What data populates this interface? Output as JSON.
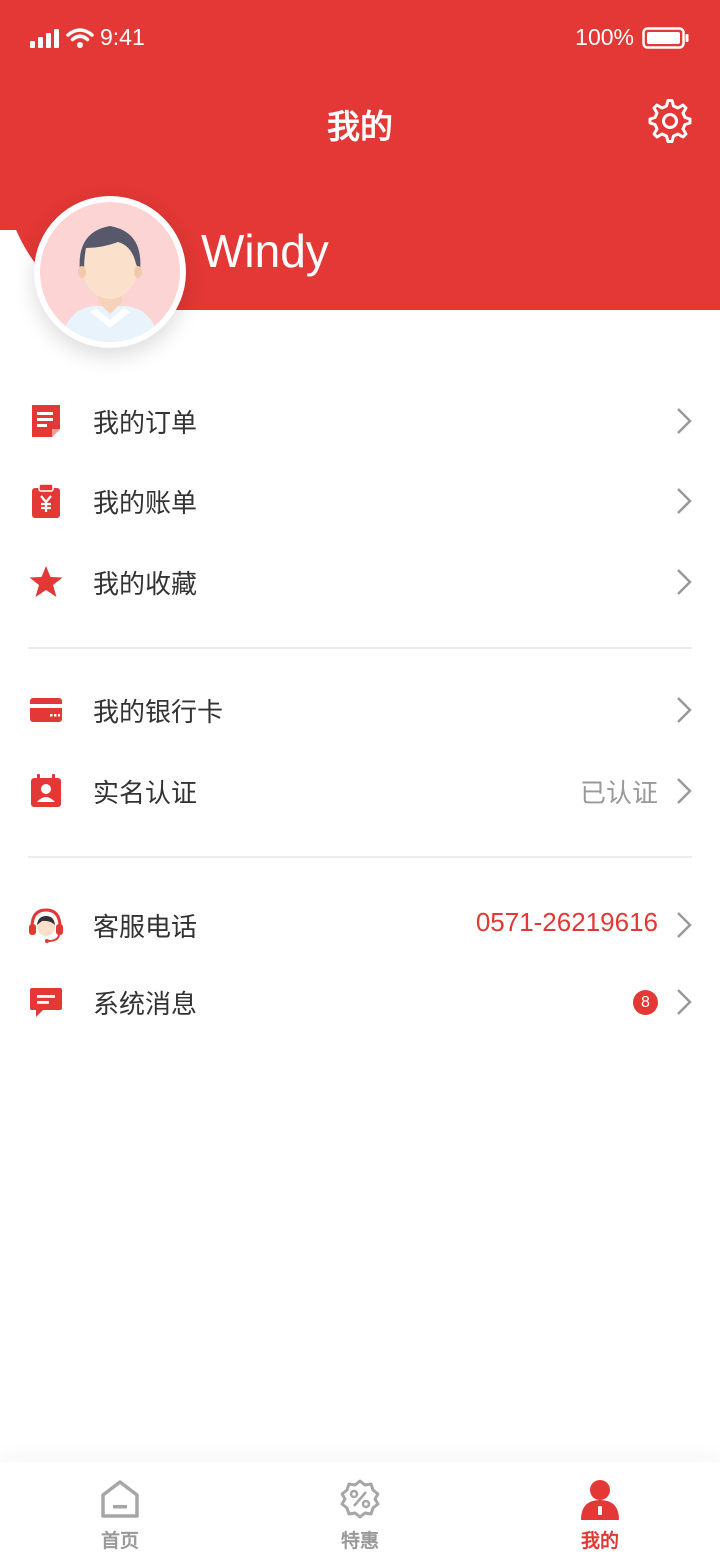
{
  "status_bar": {
    "time": "9:41",
    "battery": "100%"
  },
  "header": {
    "title": "我的",
    "username": "Windy"
  },
  "menu": [
    {
      "label": "我的订单",
      "icon": "order-icon"
    },
    {
      "label": "我的账单",
      "icon": "bill-icon"
    },
    {
      "label": "我的收藏",
      "icon": "star-icon"
    },
    {
      "label": "我的银行卡",
      "icon": "bank-card-icon"
    },
    {
      "label": "实名认证",
      "icon": "id-card-icon",
      "value": "已认证"
    },
    {
      "label": "客服电话",
      "icon": "customer-service-icon",
      "value": "0571-26219616"
    },
    {
      "label": "系统消息",
      "icon": "message-icon",
      "badge": "8"
    }
  ],
  "tabs": [
    {
      "label": "首页",
      "icon": "home-icon",
      "active": false
    },
    {
      "label": "特惠",
      "icon": "discount-icon",
      "active": false
    },
    {
      "label": "我的",
      "icon": "user-icon",
      "active": true
    }
  ],
  "colors": {
    "accent": "#e33835",
    "muted": "#999999",
    "text": "#333333"
  }
}
